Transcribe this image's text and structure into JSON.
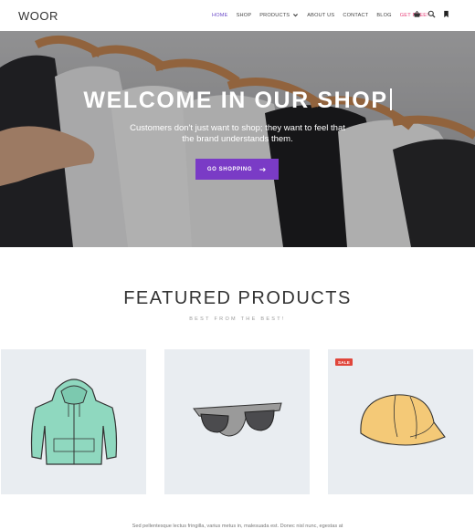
{
  "header": {
    "logo": "WOOR",
    "nav": [
      {
        "label": "HOME",
        "active": true
      },
      {
        "label": "SHOP"
      },
      {
        "label": "PRODUCTS",
        "has_dropdown": true
      },
      {
        "label": "ABOUT US"
      },
      {
        "label": "CONTACT"
      },
      {
        "label": "BLOG"
      },
      {
        "label": "GET FREE!",
        "highlight": true
      }
    ],
    "tools": [
      "basket-icon",
      "search-icon",
      "bookmark-icon"
    ]
  },
  "hero": {
    "title": "WELCOME IN OUR SHOP",
    "subtitle": "Customers don't just want to shop; they want to feel that the brand understands them.",
    "button_label": "GO SHOPPING"
  },
  "featured": {
    "title": "FEATURED PRODUCTS",
    "subtitle": "BEST FROM THE BEST!",
    "products": [
      {
        "icon": "hoodie-icon"
      },
      {
        "icon": "sunglasses-icon"
      },
      {
        "icon": "cap-icon",
        "badge": "SALE"
      }
    ]
  },
  "bottom_text": "Sed pellentesque lectus fringilla, varius metus in, malesuada est. Donec nisl nunc, egestas at",
  "colors": {
    "accent": "#7a3bc6",
    "nav_active": "#6b4ac9",
    "get_free": "#e8407a",
    "sale_badge": "#e0463b",
    "card_bg": "#e9edf1"
  }
}
